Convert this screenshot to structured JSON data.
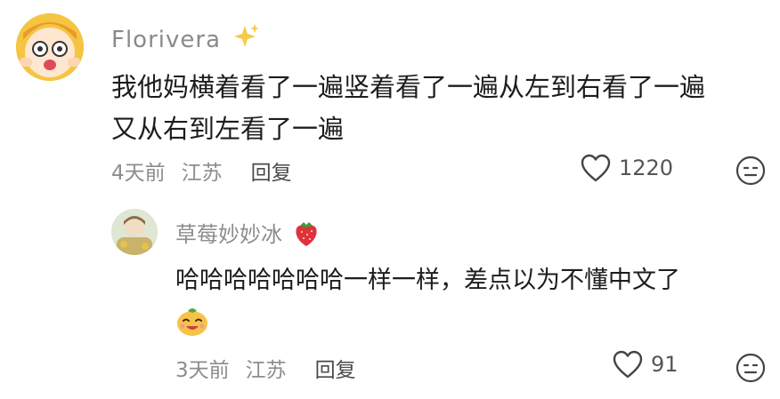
{
  "comment": {
    "username": "Florivera",
    "text_line1": "我他妈横着看了一遍竖着看了一遍从左到右看了一遍",
    "text_line2": "又从右到左看了一遍",
    "time": "4天前",
    "location": "江苏",
    "reply_label": "回复",
    "likes": "1220"
  },
  "reply": {
    "username": "草莓妙妙冰",
    "text": "哈哈哈哈哈哈哈一样一样，差点以为不懂中文了",
    "time": "3天前",
    "location": "江苏",
    "reply_label": "回复",
    "likes": "91"
  },
  "icons": {
    "sparkle": "sparkles-icon",
    "strawberry": "strawberry-icon",
    "heart": "heart-outline-icon",
    "dislike": "meh-face-icon",
    "sticker": "laughing-orange-sticker"
  },
  "colors": {
    "username": "#8a8a8a",
    "meta": "#8d8d8d",
    "text": "#1d1d1d"
  }
}
